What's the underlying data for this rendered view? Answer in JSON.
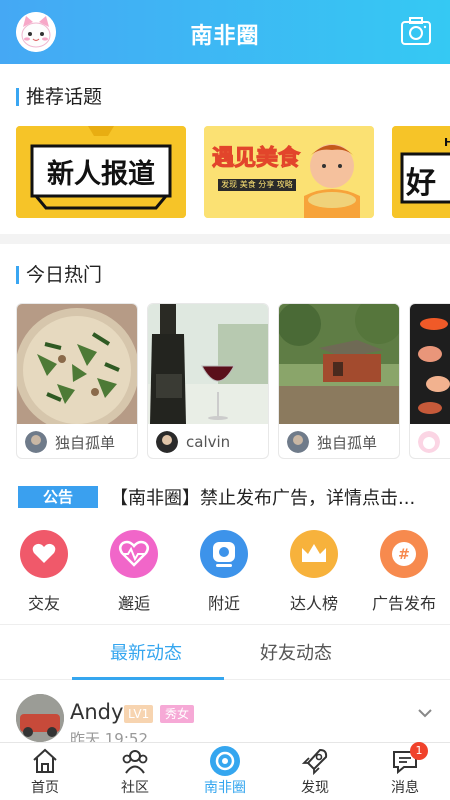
{
  "header": {
    "title": "南非圈",
    "avatar_icon": "cat-avatar-icon",
    "camera_icon": "camera-icon"
  },
  "recommended": {
    "title": "推荐话题",
    "topics": [
      {
        "label": "新人报道"
      },
      {
        "label": "遇见美食",
        "sublabel": "发现 美食 分享 攻略"
      },
      {
        "label_top": "HO",
        "label": "好"
      }
    ]
  },
  "today_hot": {
    "title": "今日热门",
    "posts": [
      {
        "user": "独自孤单"
      },
      {
        "user": "calvin"
      },
      {
        "user": "独自孤单"
      },
      {
        "user": ""
      }
    ]
  },
  "notice": {
    "badge": "公告",
    "text": "【南非圈】禁止发布广告，详情点击..."
  },
  "functions": [
    {
      "label": "交友",
      "icon": "heart-icon",
      "color": "#f0596a"
    },
    {
      "label": "邂逅",
      "icon": "heartbeat-icon",
      "color": "#f166c9"
    },
    {
      "label": "附近",
      "icon": "location-pin-icon",
      "color": "#3d93ea"
    },
    {
      "label": "达人榜",
      "icon": "crown-icon",
      "color": "#f7b23c"
    },
    {
      "label": "广告发布",
      "icon": "hash-icon",
      "color": "#f78a4e"
    }
  ],
  "feed_tabs": [
    {
      "label": "最新动态",
      "active": true
    },
    {
      "label": "好友动态",
      "active": false
    }
  ],
  "post": {
    "name": "Andy",
    "level": "LV1",
    "gender_tag": "秀女",
    "time": "昨天 19:52"
  },
  "bottom_nav": [
    {
      "label": "首页",
      "icon": "home-icon"
    },
    {
      "label": "社区",
      "icon": "community-icon"
    },
    {
      "label": "南非圈",
      "icon": "circle-camera-icon",
      "active": true
    },
    {
      "label": "发现",
      "icon": "rocket-icon"
    },
    {
      "label": "消息",
      "icon": "chat-icon",
      "badge": "1"
    }
  ],
  "colors": {
    "accent": "#35a6ef",
    "header_gradient_start": "#45a8f4",
    "header_gradient_end": "#35c9f3"
  }
}
